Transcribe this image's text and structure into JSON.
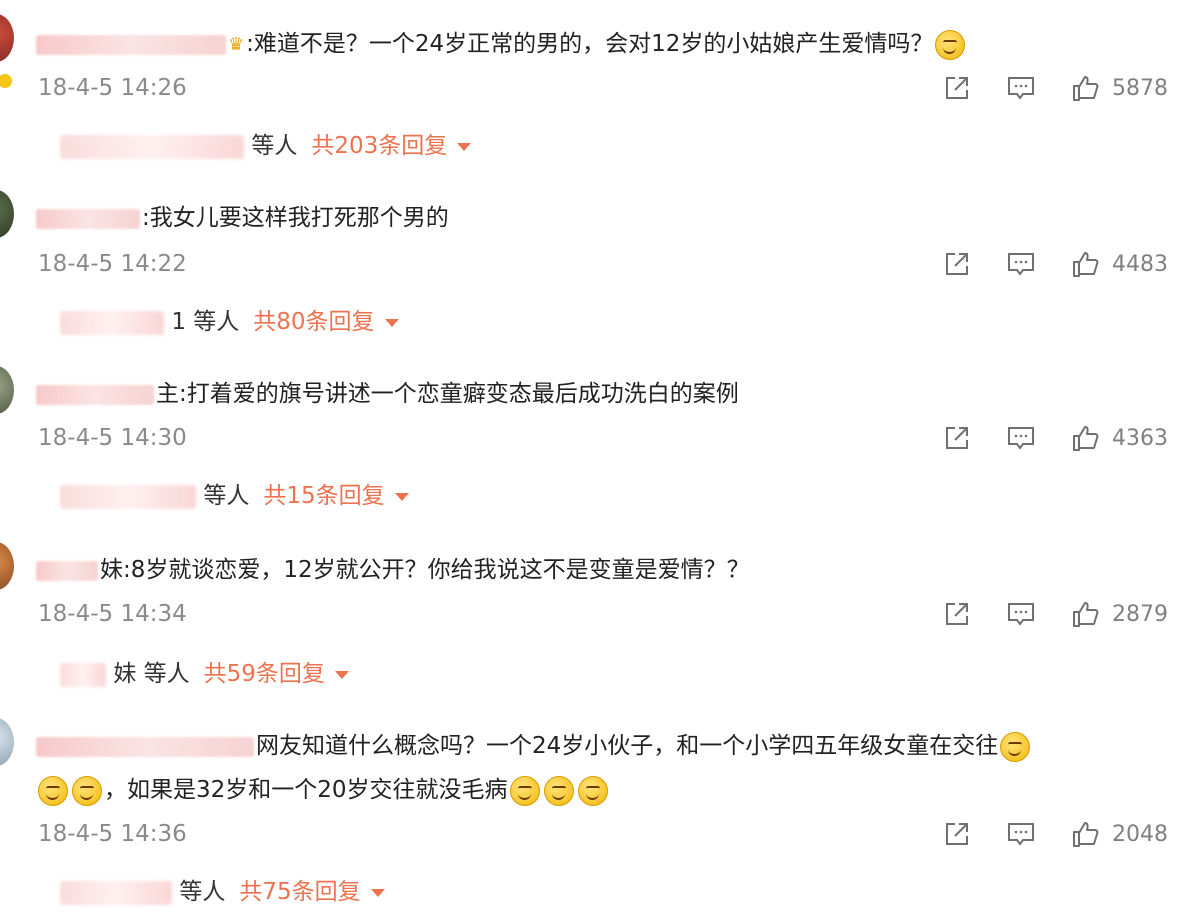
{
  "comments": [
    {
      "text": ":难道不是？一个24岁正常的男的，会对12岁的小姑娘产生爱情吗？",
      "time": "18-4-5 14:26",
      "likes": "5878",
      "reply_suffix": "等人",
      "reply_count": "共203条回复"
    },
    {
      "text": ":我女儿要这样我打死那个男的",
      "time": "18-4-5 14:22",
      "likes": "4483",
      "reply_suffix": "1 等人",
      "reply_count": "共80条回复"
    },
    {
      "text": "主:打着爱的旗号讲述一个恋童癖变态最后成功洗白的案例",
      "time": "18-4-5 14:30",
      "likes": "4363",
      "reply_suffix": "等人",
      "reply_count": "共15条回复"
    },
    {
      "text": "妹:8岁就谈恋爱，12岁就公开？你给我说这不是变童是爱情？？",
      "time": "18-4-5 14:34",
      "likes": "2879",
      "reply_suffix": "妹 等人",
      "reply_count": "共59条回复"
    },
    {
      "text_line1": "网友知道什么概念吗？一个24岁小伙子，和一个小学四五年级女童在交往",
      "text_line2": "，如果是32岁和一个20岁交往就没毛病",
      "time": "18-4-5 14:36",
      "likes": "2048",
      "reply_suffix": "等人",
      "reply_count": "共75条回复"
    }
  ],
  "icons": {
    "share": "share-icon",
    "comment": "comment-icon",
    "like": "thumbs-up-icon",
    "emoji": "smile-emoji-icon",
    "crown": "crown-icon"
  },
  "colors": {
    "accent": "#eb7350",
    "meta_text": "#8a8a8a"
  }
}
